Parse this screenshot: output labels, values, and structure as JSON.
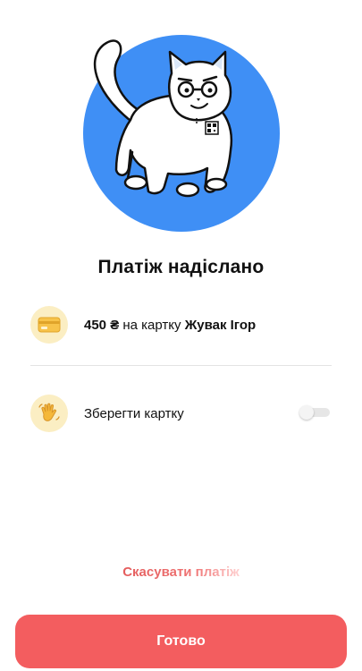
{
  "header": {
    "illustration": "cat-illustration",
    "title": "Платіж надіслано"
  },
  "payment": {
    "icon": "card-icon",
    "amount": "450 ₴",
    "connector": " на картку ",
    "recipient": "Жувак Ігор"
  },
  "save_card": {
    "icon": "waving-hand-icon",
    "label": "Зберегти картку",
    "enabled": false
  },
  "actions": {
    "cancel_label": "Скасувати платіж",
    "done_label": "Готово"
  },
  "colors": {
    "accent": "#f35d5f",
    "hero_circle": "#3f8ff5",
    "icon_background": "#fbeec3"
  }
}
